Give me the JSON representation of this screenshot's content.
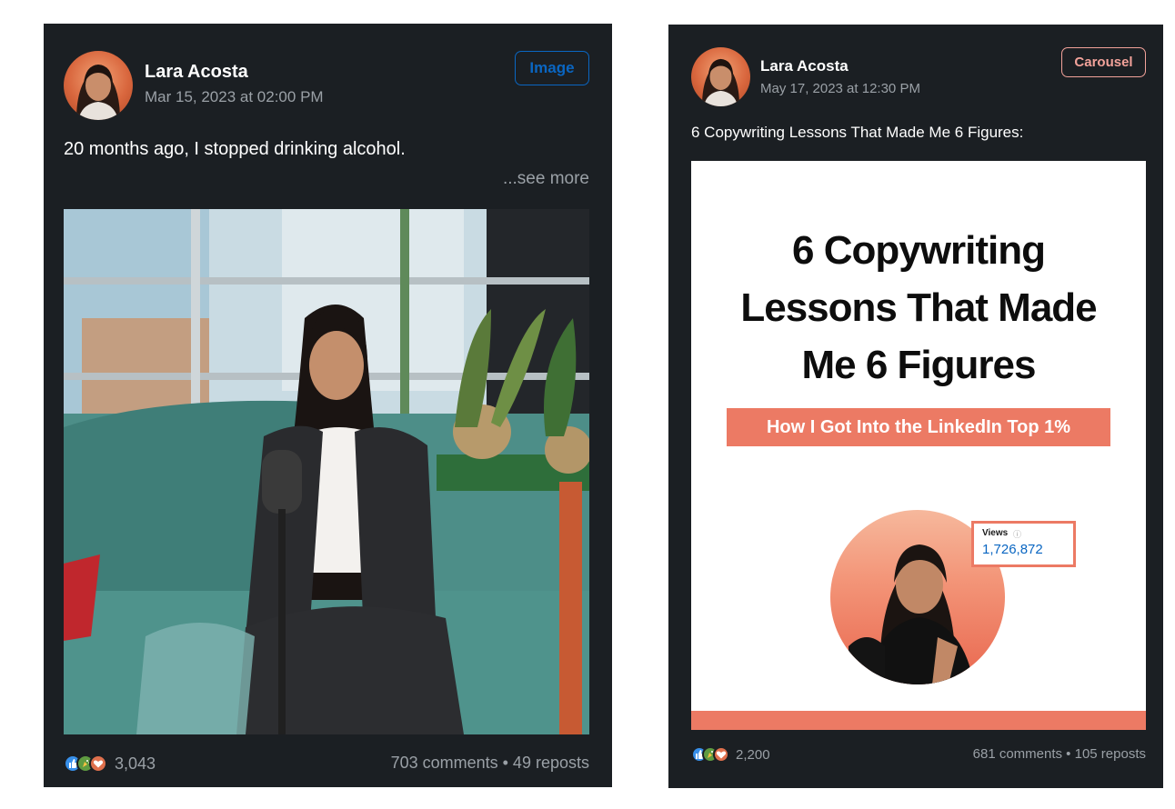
{
  "posts": [
    {
      "author": "Lara Acosta",
      "date": "Mar 15, 2023 at 02:00 PM",
      "type_badge": "Image",
      "badge_color": "#0a66c2",
      "caption": "20 months ago, I stopped drinking alcohol.",
      "see_more": "...see more",
      "reactions_count": "3,043",
      "comments_reposts": "703 comments • 49 reposts",
      "reaction_icons": [
        "like-icon",
        "celebrate-icon",
        "love-icon"
      ]
    },
    {
      "author": "Lara Acosta",
      "date": "May 17, 2023 at 12:30 PM",
      "type_badge": "Carousel",
      "badge_color": "#f2a29a",
      "caption": "6 Copywriting Lessons That Made Me 6 Figures:",
      "reactions_count": "2,200",
      "comments_reposts": "681 comments • 105 reposts",
      "reaction_icons": [
        "like-icon",
        "celebrate-icon",
        "love-icon"
      ],
      "slide": {
        "title_lines": [
          "6 Copywriting",
          "Lessons That Made",
          "Me 6 Figures"
        ],
        "banner": "How I Got Into the LinkedIn Top 1%",
        "views_label": "Views",
        "views_info_icon": "ⓘ",
        "views_value": "1,726,872",
        "accent_color": "#ec7a64"
      }
    }
  ]
}
